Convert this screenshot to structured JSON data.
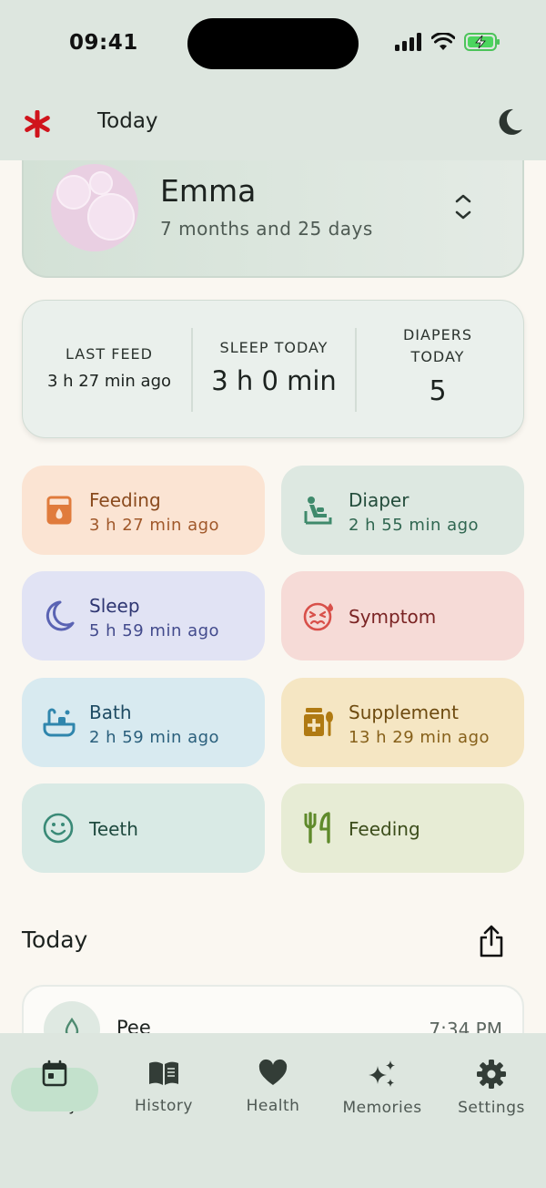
{
  "status_bar": {
    "time": "09:41"
  },
  "header": {
    "title": "Today",
    "logo_icon": "asterisk-icon",
    "theme_icon": "moon-icon"
  },
  "profile": {
    "name": "Emma",
    "age": "7 months and 25 days"
  },
  "stats": {
    "last_feed": {
      "label": "LAST FEED",
      "value": "3 h 27 min ago"
    },
    "sleep_today": {
      "label": "SLEEP TODAY",
      "value": "3 h 0 min"
    },
    "diapers_today": {
      "label_line1": "DIAPERS",
      "label_line2": "TODAY",
      "value": "5"
    }
  },
  "tiles": {
    "feeding": {
      "title": "Feeding",
      "subtitle": "3 h 27 min ago",
      "icon": "bottle-icon",
      "bg": "#fbe4d3",
      "fg": "#8a4a1d"
    },
    "diaper": {
      "title": "Diaper",
      "subtitle": "2 h 55 min ago",
      "icon": "changing-table-icon",
      "bg": "#dde8e1",
      "fg": "#234c3b"
    },
    "sleep": {
      "title": "Sleep",
      "subtitle": "5 h 59 min ago",
      "icon": "moon-icon",
      "bg": "#e1e3f4",
      "fg": "#2e3672"
    },
    "symptom": {
      "title": "Symptom",
      "icon": "sick-face-icon",
      "bg": "#f6dbd7",
      "fg": "#7a2323"
    },
    "bath": {
      "title": "Bath",
      "subtitle": "2 h 59 min ago",
      "icon": "bathtub-icon",
      "bg": "#d8eaf0",
      "fg": "#1d4a62"
    },
    "supplement": {
      "title": "Supplement",
      "subtitle": "13 h 29 min ago",
      "icon": "medicine-icon",
      "bg": "#f5e6c3",
      "fg": "#6d4a0f"
    },
    "teeth": {
      "title": "Teeth",
      "icon": "smile-icon",
      "bg": "#d9eae5",
      "fg": "#1f4a3f"
    },
    "solid_feeding": {
      "title": "Feeding",
      "icon": "utensils-icon",
      "bg": "#e7ecd5",
      "fg": "#3c4d1b"
    }
  },
  "today_section": {
    "title": "Today",
    "share_icon": "share-icon"
  },
  "entries": [
    {
      "title": "Pee",
      "time": "7:34 PM",
      "icon": "droplet-icon"
    }
  ],
  "tab_bar": {
    "tabs": [
      {
        "label": "Today",
        "icon": "calendar-icon",
        "active": true
      },
      {
        "label": "History",
        "icon": "book-icon"
      },
      {
        "label": "Health",
        "icon": "heart-icon"
      },
      {
        "label": "Memories",
        "icon": "sparkles-icon"
      },
      {
        "label": "Settings",
        "icon": "gear-icon"
      }
    ]
  }
}
